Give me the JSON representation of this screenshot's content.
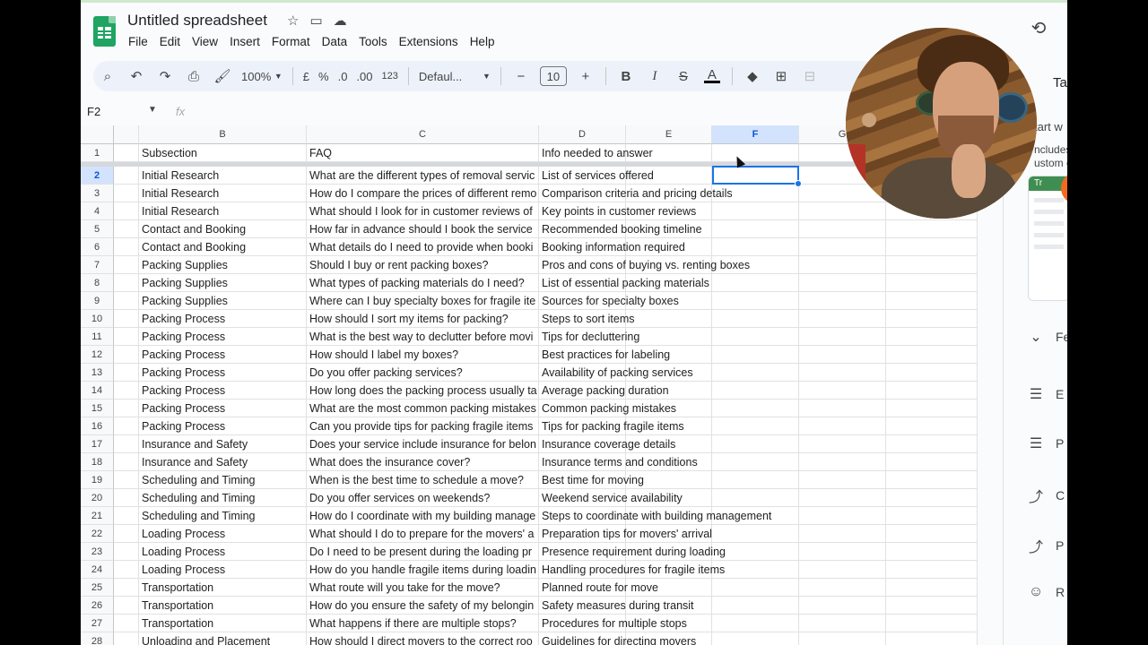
{
  "doc": {
    "title": "Untitled spreadsheet"
  },
  "menu": [
    "File",
    "Edit",
    "View",
    "Insert",
    "Format",
    "Data",
    "Tools",
    "Extensions",
    "Help"
  ],
  "toolbar": {
    "zoom": "100%",
    "currency": "£",
    "percent": "%",
    "dec_decrease": ".0",
    "dec_increase": ".00",
    "number_format": "123",
    "font": "Defaul...",
    "font_size": "10",
    "bold": "B",
    "italic": "I",
    "strike": "S",
    "text_color": "A"
  },
  "formula_bar": {
    "name_box": "F2",
    "fx": "fx"
  },
  "columns": [
    "B",
    "C",
    "D",
    "E",
    "F",
    "G"
  ],
  "rows": [
    {
      "n": "1",
      "b": "Subsection",
      "c": "FAQ",
      "d": "Info needed to answer"
    },
    {
      "n": "2",
      "b": "Initial Research",
      "c": "What are the different types of removal servic",
      "d": "List of services offered"
    },
    {
      "n": "3",
      "b": "Initial Research",
      "c": "How do I compare the prices of different remo",
      "d": "Comparison criteria and pricing details"
    },
    {
      "n": "4",
      "b": "Initial Research",
      "c": "What should I look for in customer reviews of",
      "d": "Key points in customer reviews"
    },
    {
      "n": "5",
      "b": "Contact and Booking",
      "c": "How far in advance should I book the service",
      "d": "Recommended booking timeline"
    },
    {
      "n": "6",
      "b": "Contact and Booking",
      "c": "What details do I need to provide when booki",
      "d": "Booking information required"
    },
    {
      "n": "7",
      "b": "Packing Supplies",
      "c": "Should I buy or rent packing boxes?",
      "d": "Pros and cons of buying vs. renting boxes"
    },
    {
      "n": "8",
      "b": "Packing Supplies",
      "c": "What types of packing materials do I need?",
      "d": "List of essential packing materials"
    },
    {
      "n": "9",
      "b": "Packing Supplies",
      "c": "Where can I buy specialty boxes for fragile ite",
      "d": "Sources for specialty boxes"
    },
    {
      "n": "10",
      "b": "Packing Process",
      "c": "How should I sort my items for packing?",
      "d": "Steps to sort items"
    },
    {
      "n": "11",
      "b": "Packing Process",
      "c": "What is the best way to declutter before movi",
      "d": "Tips for decluttering"
    },
    {
      "n": "12",
      "b": "Packing Process",
      "c": "How should I label my boxes?",
      "d": "Best practices for labeling"
    },
    {
      "n": "13",
      "b": "Packing Process",
      "c": "Do you offer packing services?",
      "d": "Availability of packing services"
    },
    {
      "n": "14",
      "b": "Packing Process",
      "c": "How long does the packing process usually ta",
      "d": "Average packing duration"
    },
    {
      "n": "15",
      "b": "Packing Process",
      "c": "What are the most common packing mistakes",
      "d": "Common packing mistakes"
    },
    {
      "n": "16",
      "b": "Packing Process",
      "c": "Can you provide tips for packing fragile items",
      "d": "Tips for packing fragile items"
    },
    {
      "n": "17",
      "b": "Insurance and Safety",
      "c": "Does your service include insurance for belon",
      "d": "Insurance coverage details"
    },
    {
      "n": "18",
      "b": "Insurance and Safety",
      "c": "What does the insurance cover?",
      "d": "Insurance terms and conditions"
    },
    {
      "n": "19",
      "b": "Scheduling and Timing",
      "c": "When is the best time to schedule a move?",
      "d": "Best time for moving"
    },
    {
      "n": "20",
      "b": "Scheduling and Timing",
      "c": "Do you offer services on weekends?",
      "d": "Weekend service availability"
    },
    {
      "n": "21",
      "b": "Scheduling and Timing",
      "c": "How do I coordinate with my building manage",
      "d": "Steps to coordinate with building management"
    },
    {
      "n": "22",
      "b": "Loading Process",
      "c": "What should I do to prepare for the movers' a",
      "d": "Preparation tips for movers' arrival"
    },
    {
      "n": "23",
      "b": "Loading Process",
      "c": "Do I need to be present during the loading pr",
      "d": "Presence requirement during loading"
    },
    {
      "n": "24",
      "b": "Loading Process",
      "c": "How do you handle fragile items during loadin",
      "d": "Handling procedures for fragile items"
    },
    {
      "n": "25",
      "b": "Transportation",
      "c": "What route will you take for the move?",
      "d": "Planned route for move"
    },
    {
      "n": "26",
      "b": "Transportation",
      "c": "How do you ensure the safety of my belongin",
      "d": "Safety measures during transit"
    },
    {
      "n": "27",
      "b": "Transportation",
      "c": "What happens if there are multiple stops?",
      "d": "Procedures for multiple stops"
    },
    {
      "n": "28",
      "b": "Unloading and Placement",
      "c": "How should I direct movers to the correct roo",
      "d": "Guidelines for directing movers"
    }
  ],
  "side_panel": {
    "title": "Ta",
    "start": "tart w",
    "includes": "ncludes",
    "custom": "ustom c",
    "card_header": "Tr",
    "section": "Feat",
    "items": [
      {
        "icon": "checklist-icon",
        "label": "E"
      },
      {
        "icon": "checklist-icon",
        "label": "P"
      },
      {
        "icon": "trend-icon",
        "label": "C"
      },
      {
        "icon": "trend-icon",
        "label": "P"
      },
      {
        "icon": "person-icon",
        "label": "R"
      }
    ]
  },
  "colors": {
    "accent": "#1a73e8",
    "sheets_green": "#1fa463",
    "toolbar_bg": "#edf2fa",
    "selected_header": "#d3e3fd"
  }
}
